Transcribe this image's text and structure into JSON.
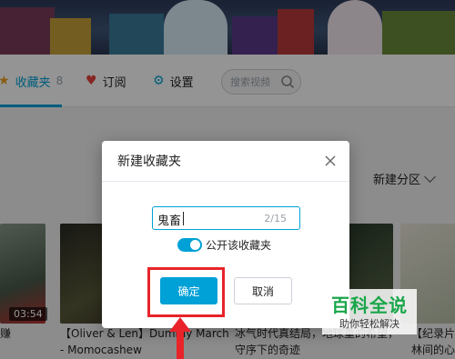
{
  "nav": {
    "favorites_label": "收藏夹",
    "favorites_count": "8",
    "subscriptions_label": "订阅",
    "settings_label": "设置",
    "search_placeholder": "搜索视频"
  },
  "content": {
    "partition_label": "新建分区",
    "videos": [
      {
        "duration": "",
        "title": "赚"
      },
      {
        "duration": "03:54",
        "title": "【Oliver & Len】Dummy March",
        "subtitle": "- Momocashew"
      },
      {
        "duration": "",
        "title": "冰气时代真结局，地球重的希望，",
        "subtitle": "守序下的奇迹"
      },
      {
        "duration": "",
        "title": "【纪录片】",
        "subtitle": "林间的心机"
      }
    ]
  },
  "dialog": {
    "title": "新建收藏夹",
    "name_value": "鬼畜",
    "name_counter": "2/15",
    "public_toggle_label": "公开该收藏夹",
    "public_toggle_on": true,
    "confirm_label": "确定",
    "cancel_label": "取消"
  },
  "watermark": {
    "main": "百科全说",
    "sub": "助你轻松解决"
  },
  "colors": {
    "accent": "#00a1d6",
    "highlight": "#e8242a",
    "watermark_green": "#1aa64a"
  }
}
